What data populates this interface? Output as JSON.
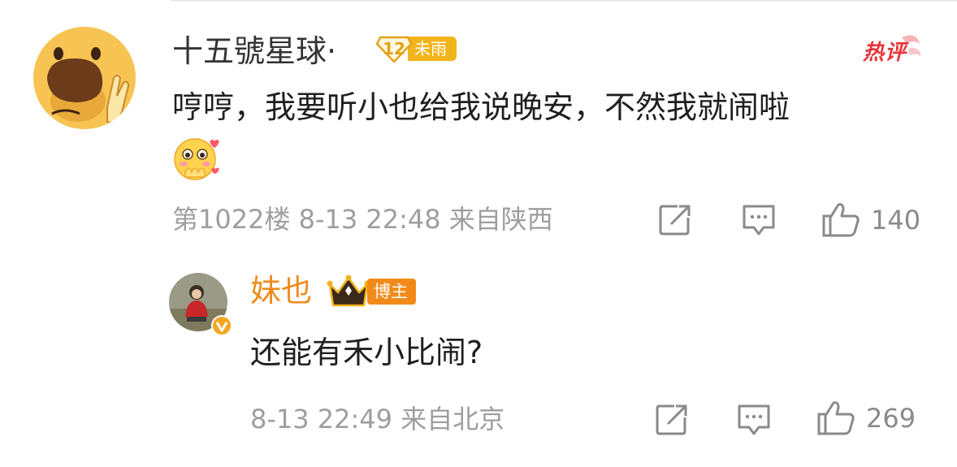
{
  "main_comment": {
    "username": "十五號星球·",
    "level_number": "12",
    "level_label": "未雨",
    "hot_tag": "热评",
    "text": "哼哼，我要听小也给我说晚安，不然我就闹啦",
    "emoji": "shy-face-emoji",
    "meta": "第1022楼 8-13 22:48 来自陕西",
    "like_count": "140"
  },
  "reply": {
    "username": "妹也",
    "role_label": "博主",
    "text": "还能有禾小比闹?",
    "meta": "8-13 22:49 来自北京",
    "like_count": "269"
  },
  "icons": {
    "share": "share-icon",
    "comment": "comment-icon",
    "like": "thumbs-up-icon",
    "verified": "verified-badge-icon",
    "crown": "crown-icon"
  },
  "colors": {
    "level_badge": "#f2b41c",
    "hot_tag": "#e6353b",
    "reply_username": "#f08a1a",
    "blogger_badge": "#f28a1a",
    "meta_text": "#9e9e9e"
  }
}
